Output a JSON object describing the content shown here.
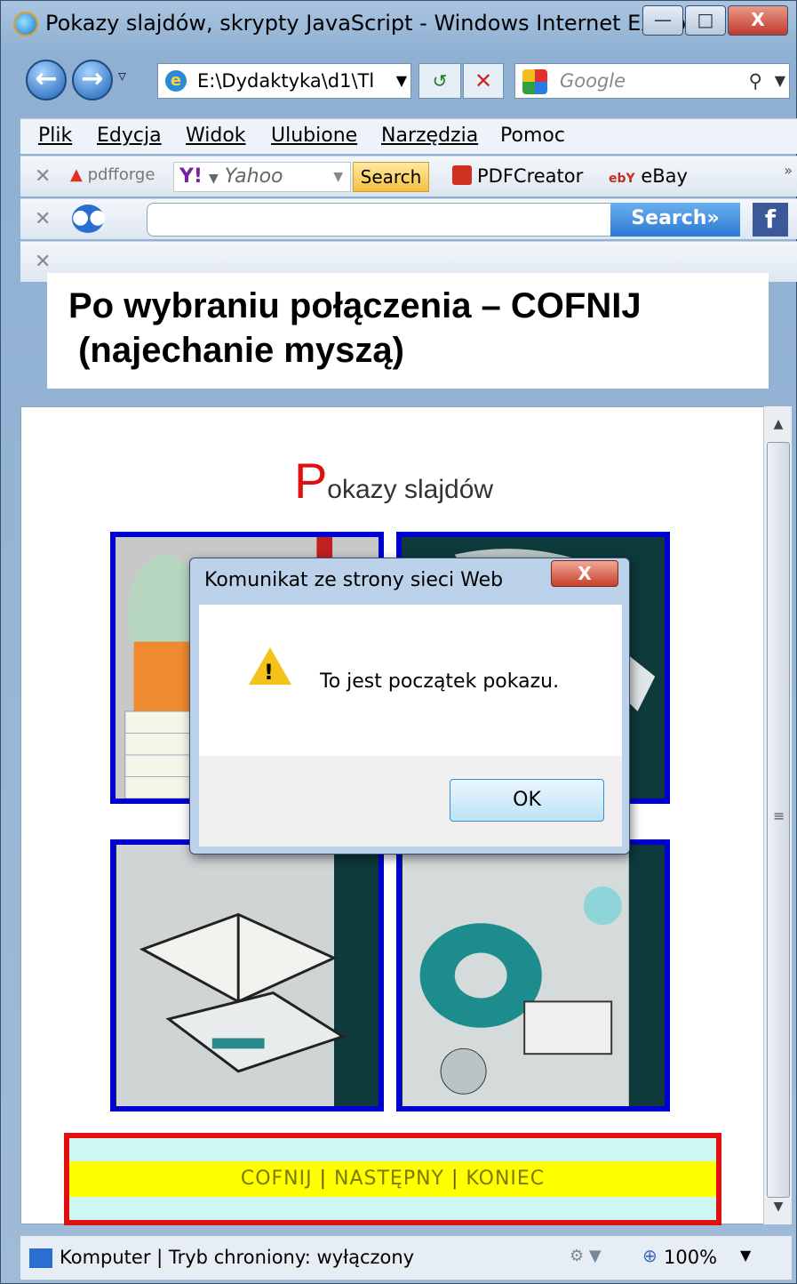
{
  "window": {
    "title": "Pokazy slajdów, skrypty JavaScript - Windows Internet Explor...",
    "minimize": "—",
    "maximize": "□",
    "close": "X"
  },
  "navigation": {
    "address": "E:\\Dydaktyka\\d1\\Tl",
    "search_placeholder": "Google"
  },
  "menu": [
    "Plik",
    "Edycja",
    "Widok",
    "Ulubione",
    "Narzędzia",
    "Pomoc"
  ],
  "toolbar1": {
    "pdfforge": "pdfforge",
    "yahoo_logo": "Y!",
    "yahoo_text": "Yahoo",
    "search_button": "Search",
    "pdfcreator": "PDFCreator",
    "ebay": "eBay"
  },
  "toolbar2": {
    "search_button": "Search»",
    "facebook": "f"
  },
  "caption": {
    "line1": "Po wybraniu połączenia – COFNIJ",
    "line2": " (najechanie myszą)"
  },
  "page": {
    "title_initial": "P",
    "title_rest": "okazy slajdów",
    "nav_links": [
      "COFNIJ",
      "NASTĘPNY",
      "KONIEC"
    ],
    "separator": "|"
  },
  "dialog": {
    "title": "Komunikat ze strony sieci Web",
    "message": "To jest początek pokazu.",
    "ok_label": "OK",
    "close": "X"
  },
  "status": {
    "text": "Komputer | Tryb chroniony: wyłączony",
    "zoom": "100%"
  },
  "colors": {
    "title_accent": "#e01010",
    "panel_border": "#0000d0",
    "nav_border": "#e01010",
    "nav_highlight": "#ffff00"
  }
}
